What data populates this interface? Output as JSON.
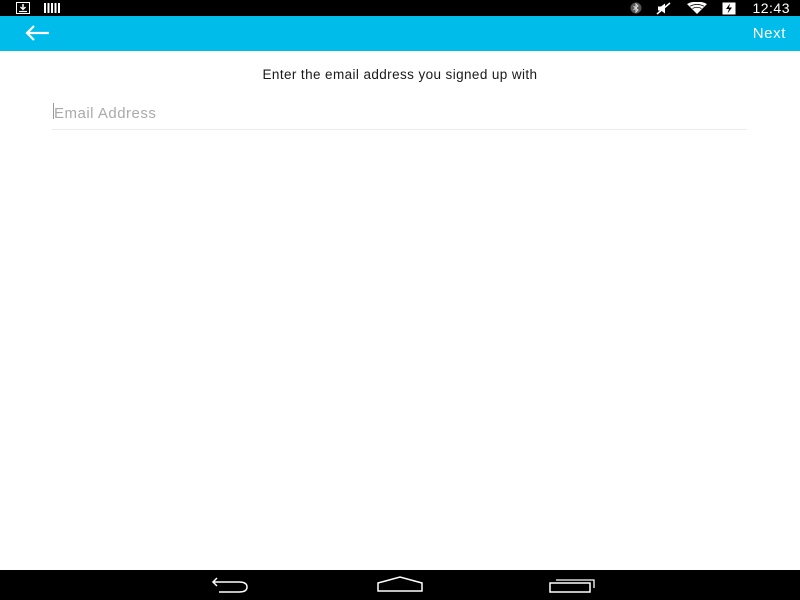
{
  "status_bar": {
    "time": "12:43",
    "left_icons": [
      "download-icon",
      "signal-bars-icon"
    ],
    "right_icons": [
      "bluetooth-icon",
      "muted-icon",
      "wifi-icon",
      "battery-charging-icon"
    ]
  },
  "app_bar": {
    "next_label": "Next",
    "back_icon": "arrow-left-icon",
    "color": "#00bcea"
  },
  "form": {
    "prompt": "Enter the email address you signed up with",
    "email": {
      "placeholder": "Email Address",
      "value": ""
    }
  },
  "nav_bar": {
    "icons": [
      "nav-back-icon",
      "nav-home-icon",
      "nav-recents-icon"
    ]
  }
}
